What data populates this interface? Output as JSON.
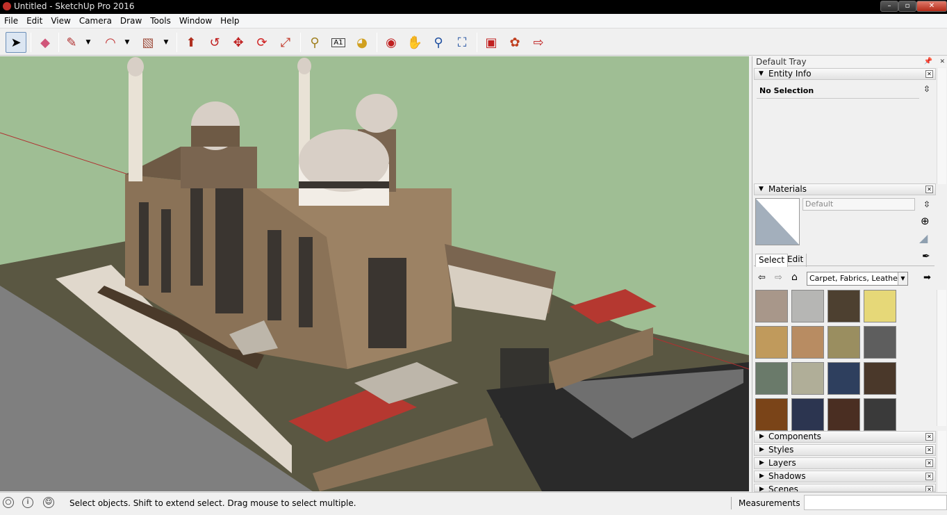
{
  "window": {
    "title": "Untitled - SketchUp Pro 2016"
  },
  "menu": [
    "File",
    "Edit",
    "View",
    "Camera",
    "Draw",
    "Tools",
    "Window",
    "Help"
  ],
  "toolbar": {
    "tools": [
      {
        "name": "select-tool",
        "icon": "arrow-icon"
      },
      {
        "name": "eraser-tool",
        "icon": "eraser-icon"
      },
      {
        "name": "line-tool",
        "icon": "pencil-icon"
      },
      {
        "name": "arc-tool",
        "icon": "arc-icon"
      },
      {
        "name": "rectangle-tool",
        "icon": "rectangle-icon"
      },
      {
        "name": "push-pull-tool",
        "icon": "push-pull-icon"
      },
      {
        "name": "offset-tool",
        "icon": "offset-icon"
      },
      {
        "name": "move-tool",
        "icon": "move-icon"
      },
      {
        "name": "rotate-tool",
        "icon": "rotate-icon"
      },
      {
        "name": "scale-tool",
        "icon": "scale-icon"
      },
      {
        "name": "tape-measure-tool",
        "icon": "tape-icon"
      },
      {
        "name": "text-tool",
        "icon": "text-icon"
      },
      {
        "name": "paint-bucket-tool",
        "icon": "paint-bucket-icon"
      },
      {
        "name": "orbit-tool",
        "icon": "orbit-icon"
      },
      {
        "name": "pan-tool",
        "icon": "hand-icon"
      },
      {
        "name": "zoom-tool",
        "icon": "magnifier-icon"
      },
      {
        "name": "zoom-extents-tool",
        "icon": "zoom-extents-icon"
      },
      {
        "name": "warehouse-tool",
        "icon": "warehouse-icon"
      },
      {
        "name": "extension-warehouse-tool",
        "icon": "extension-icon"
      },
      {
        "name": "send-to-layout-tool",
        "icon": "layout-icon"
      }
    ],
    "text_tool_glyph": "A1"
  },
  "tray": {
    "title": "Default Tray",
    "entity_info": {
      "label": "Entity Info",
      "selection": "No Selection"
    },
    "materials": {
      "label": "Materials",
      "name_placeholder": "Default",
      "tab_select": "Select",
      "tab_edit": "Edit",
      "library": "Carpet, Fabrics, Leathers, Te",
      "swatch_colors": [
        "#a8978a",
        "#b6b6b4",
        "#4d4030",
        "#e6d878",
        "#c09a5c",
        "#b88c62",
        "#9a8e60",
        "#5e5e5e",
        "#6a7a6a",
        "#b0ae98",
        "#2e3f5e",
        "#4a382a",
        "#7a4418",
        "#2c3550",
        "#4a2e22",
        "#3a3a3a"
      ]
    },
    "collapsed_panels": [
      "Components",
      "Styles",
      "Layers",
      "Shadows",
      "Scenes"
    ]
  },
  "statusbar": {
    "hint": "Select objects. Shift to extend select. Drag mouse to select multiple.",
    "measurements_label": "Measurements",
    "measurements_value": ""
  },
  "colors": {
    "sky": "#9fbe94",
    "ground": "#5e5a44",
    "walls": "#8a7257",
    "domes": "#d8cfc6",
    "roof": "#b53830"
  }
}
